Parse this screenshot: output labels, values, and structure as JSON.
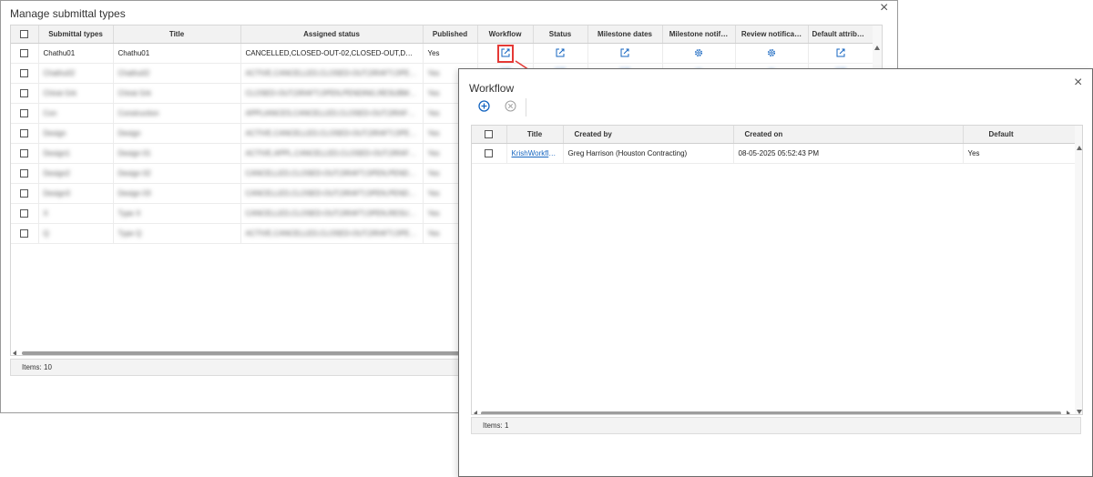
{
  "main_dialog": {
    "title": "Manage submittal types",
    "columns": [
      "Submittal types",
      "Title",
      "Assigned status",
      "Published",
      "Workflow",
      "Status",
      "Milestone dates",
      "Milestone notif…",
      "Review notifica…",
      "Default attribut…"
    ],
    "rows": [
      {
        "type": "Chathu01",
        "title": "Chathu01",
        "status": "CANCELLED,CLOSED-OUT-02,CLOSED-OUT,DRAFT,O…",
        "published": "Yes"
      }
    ],
    "blurred_rows": [
      {
        "type": "Chathu02",
        "title": "Chathu02",
        "status": "ACTIVE,CANCELLED,CLOSED-OUT,DRAFT,OPEN,REV…",
        "published": "Yes"
      },
      {
        "type": "Chirat Grk",
        "title": "Chirat Grk",
        "status": "CLOSED-OUT,DRAFT,OPEN,PENDING,RESUBMIT,RE…",
        "published": "Yes"
      },
      {
        "type": "Con",
        "title": "Construction",
        "status": "APPLIANCES,CANCELLED,CLOSED-OUT,DRAFT,OPE…",
        "published": "Yes"
      },
      {
        "type": "Design",
        "title": "Design",
        "status": "ACTIVE,CANCELLED,CLOSED-OUT,DRAFT,OPEN,RE…",
        "published": "Yes"
      },
      {
        "type": "Design1",
        "title": "Design 01",
        "status": "ACTIVE,APPL,CANCELLED,CLOSED-OUT,DRAFT…",
        "published": "Yes"
      },
      {
        "type": "Design2",
        "title": "Design 02",
        "status": "CANCELLED,CLOSED-OUT,DRAFT,OPEN,PENDING,R…",
        "published": "Yes"
      },
      {
        "type": "Design3",
        "title": "Design 03",
        "status": "CANCELLED,CLOSED-OUT,DRAFT,OPEN,PENDING,R…",
        "published": "Yes"
      },
      {
        "type": "X",
        "title": "Type X",
        "status": "CANCELLED,CLOSED-OUT,DRAFT,OPEN,RESUBMIT,…",
        "published": "Yes"
      },
      {
        "type": "Q",
        "title": "Type Q",
        "status": "ACTIVE,CANCELLED,CLOSED-OUT,DRAFT,OPEN,R…",
        "published": "Yes"
      }
    ],
    "footer": "Items: 10"
  },
  "workflow_dialog": {
    "title": "Workflow",
    "columns": [
      "Title",
      "Created by",
      "Created on",
      "Default"
    ],
    "rows": [
      {
        "title": "KrishWorkflo…",
        "created_by": "Greg Harrison (Houston Contracting)",
        "created_on": "08-05-2025 05:52:43 PM",
        "default": "Yes"
      }
    ],
    "footer": "Items: 1"
  },
  "colors": {
    "accent": "#1565c0",
    "highlight": "#e53935"
  },
  "icons": [
    "close-icon",
    "edit-icon",
    "gear-icon",
    "add-icon",
    "remove-icon"
  ]
}
